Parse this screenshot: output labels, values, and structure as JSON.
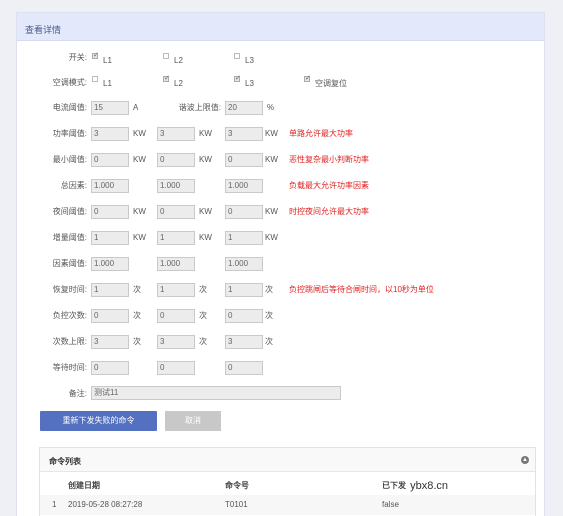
{
  "panel": {
    "title": "查看详情"
  },
  "switch": {
    "label": "开关:",
    "options": [
      {
        "text": "L1",
        "checked": true
      },
      {
        "text": "L2",
        "checked": false
      },
      {
        "text": "L3",
        "checked": false
      }
    ]
  },
  "ac_mode": {
    "label": "空调模式:",
    "options": [
      {
        "text": "L1",
        "checked": false
      },
      {
        "text": "L2",
        "checked": true
      },
      {
        "text": "L3",
        "checked": true
      },
      {
        "text": "空调复位",
        "checked": true
      }
    ]
  },
  "current": {
    "label": "电流阈值:",
    "value": "15",
    "unit": "A",
    "harmonic_label": "谐波上限值:",
    "harmonic_value": "20",
    "harmonic_unit": "%"
  },
  "rows": [
    {
      "label": "功率阈值:",
      "values": [
        "3",
        "3",
        "3"
      ],
      "unit": "KW",
      "hint": "单路允许最大功率"
    },
    {
      "label": "最小阈值:",
      "values": [
        "0",
        "0",
        "0"
      ],
      "unit": "KW",
      "hint": "恶性复杂最小判断功率"
    },
    {
      "label": "总因素:",
      "values": [
        "1.000",
        "1.000",
        "1.000"
      ],
      "unit": "",
      "hint": "负载最大允许功率因素"
    },
    {
      "label": "夜间阈值:",
      "values": [
        "0",
        "0",
        "0"
      ],
      "unit": "KW",
      "hint": "时控夜间允许最大功率"
    },
    {
      "label": "增量阈值:",
      "values": [
        "1",
        "1",
        "1"
      ],
      "unit": "KW",
      "hint": ""
    },
    {
      "label": "因素阈值:",
      "values": [
        "1.000",
        "1.000",
        "1.000"
      ],
      "unit": "",
      "hint": ""
    },
    {
      "label": "恢复时间:",
      "values": [
        "1",
        "1",
        "1"
      ],
      "unit": "次",
      "hint": "负控跳闸后等待合闸时间，以10秒为单位"
    },
    {
      "label": "负控次数:",
      "values": [
        "0",
        "0",
        "0"
      ],
      "unit": "次",
      "hint": ""
    },
    {
      "label": "次数上限:",
      "values": [
        "3",
        "3",
        "3"
      ],
      "unit": "次",
      "hint": ""
    },
    {
      "label": "等待时间:",
      "values": [
        "0",
        "0",
        "0"
      ],
      "unit": "",
      "hint": ""
    }
  ],
  "remark": {
    "label": "备注:",
    "value": "测试11"
  },
  "buttons": {
    "resend": "重新下发失败的命令",
    "cancel": "取消"
  },
  "commands": {
    "title": "命令列表",
    "columns": [
      "创建日期",
      "命令号",
      "已下发"
    ],
    "rows": [
      {
        "index": "1",
        "date": "2019-05-28 08:27:28",
        "code": "T0101",
        "sent": "false"
      }
    ]
  },
  "watermark": "ybx8.cn"
}
